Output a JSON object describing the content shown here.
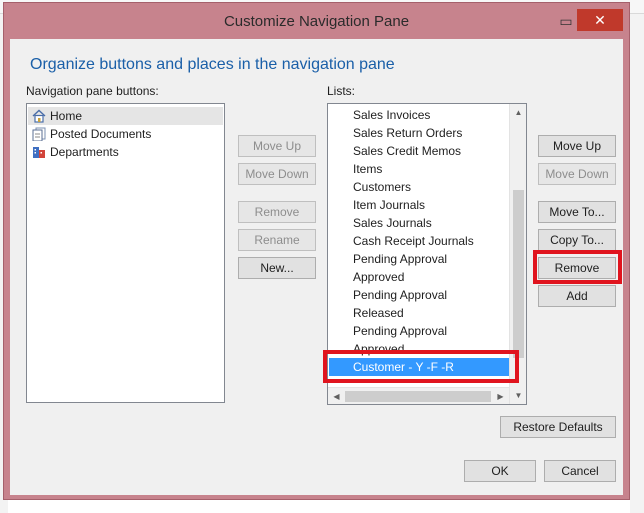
{
  "dialog": {
    "title": "Customize Navigation Pane",
    "heading": "Organize buttons and places in the navigation pane",
    "nav_label": "Navigation pane buttons:",
    "lists_label": "Lists:",
    "close_glyph": "✕",
    "minimize_glyph": "▭"
  },
  "nav_items": [
    {
      "label": "Home",
      "icon": "home-icon",
      "selected": true
    },
    {
      "label": "Posted Documents",
      "icon": "posted-documents-icon",
      "selected": false
    },
    {
      "label": "Departments",
      "icon": "departments-icon",
      "selected": false
    }
  ],
  "lists": [
    "Sales Invoices",
    "Sales Return Orders",
    "Sales Credit Memos",
    "Items",
    "Customers",
    "Item Journals",
    "Sales Journals",
    "Cash Receipt Journals",
    "Pending Approval",
    "Approved",
    "Pending Approval",
    "Released",
    "Pending Approval",
    "Approved",
    "Customer - Y -F -R"
  ],
  "selected_list_index": 14,
  "middle_buttons": {
    "move_up": "Move Up",
    "move_down": "Move Down",
    "remove": "Remove",
    "rename": "Rename",
    "new": "New..."
  },
  "right_buttons": {
    "move_up": "Move Up",
    "move_down": "Move Down",
    "move_to": "Move To...",
    "copy_to": "Copy To...",
    "remove": "Remove",
    "add": "Add"
  },
  "footer": {
    "restore_defaults": "Restore Defaults",
    "ok": "OK",
    "cancel": "Cancel"
  },
  "colors": {
    "frame": "#c7838d",
    "accent": "#1a5fa8",
    "selection": "#3399ff",
    "highlight": "#e0141e"
  }
}
